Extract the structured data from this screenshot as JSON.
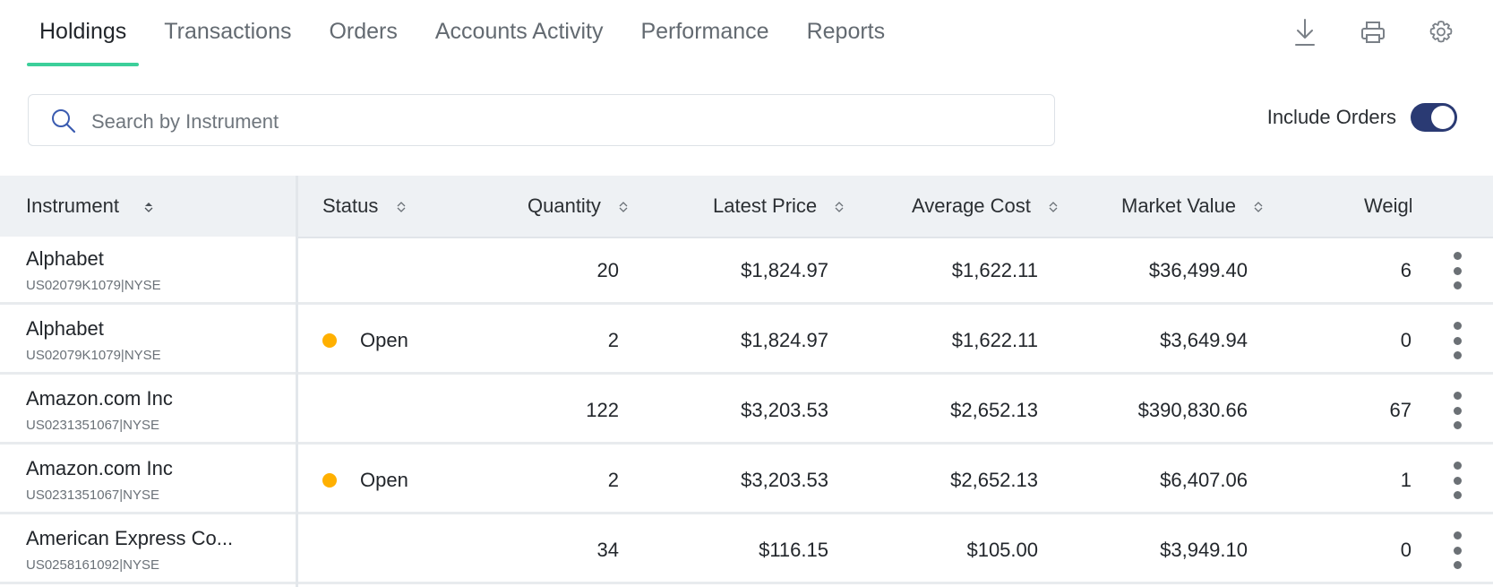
{
  "tabs": [
    {
      "label": "Holdings",
      "active": true
    },
    {
      "label": "Transactions"
    },
    {
      "label": "Orders"
    },
    {
      "label": "Accounts Activity"
    },
    {
      "label": "Performance"
    },
    {
      "label": "Reports"
    }
  ],
  "toolbar": {
    "icons": [
      "download-icon",
      "print-icon",
      "gear-icon"
    ]
  },
  "search": {
    "placeholder": "Search by Instrument",
    "value": ""
  },
  "include_orders": {
    "label": "Include Orders",
    "on": true
  },
  "table": {
    "columns": [
      "Instrument",
      "Status",
      "Quantity",
      "Latest Price",
      "Average Cost",
      "Market Value",
      "Weigl"
    ],
    "rows": [
      {
        "name": "Alphabet",
        "id": "US02079K1079|NYSE",
        "status": "",
        "quantity": "20",
        "latest_price": "$1,824.97",
        "average_cost": "$1,622.11",
        "market_value": "$36,499.40",
        "weight": "6"
      },
      {
        "name": "Alphabet",
        "id": "US02079K1079|NYSE",
        "status": "Open",
        "quantity": "2",
        "latest_price": "$1,824.97",
        "average_cost": "$1,622.11",
        "market_value": "$3,649.94",
        "weight": "0"
      },
      {
        "name": "Amazon.com Inc",
        "id": "US0231351067|NYSE",
        "status": "",
        "quantity": "122",
        "latest_price": "$3,203.53",
        "average_cost": "$2,652.13",
        "market_value": "$390,830.66",
        "weight": "67"
      },
      {
        "name": "Amazon.com Inc",
        "id": "US0231351067|NYSE",
        "status": "Open",
        "quantity": "2",
        "latest_price": "$3,203.53",
        "average_cost": "$2,652.13",
        "market_value": "$6,407.06",
        "weight": "1"
      },
      {
        "name": "American Express Co...",
        "id": "US0258161092|NYSE",
        "status": "",
        "quantity": "34",
        "latest_price": "$116.15",
        "average_cost": "$105.00",
        "market_value": "$3,949.10",
        "weight": "0"
      }
    ]
  },
  "colors": {
    "accent_tab": "#3ccf9a",
    "toggle": "#2a3a73",
    "status_open": "#ffb000"
  }
}
